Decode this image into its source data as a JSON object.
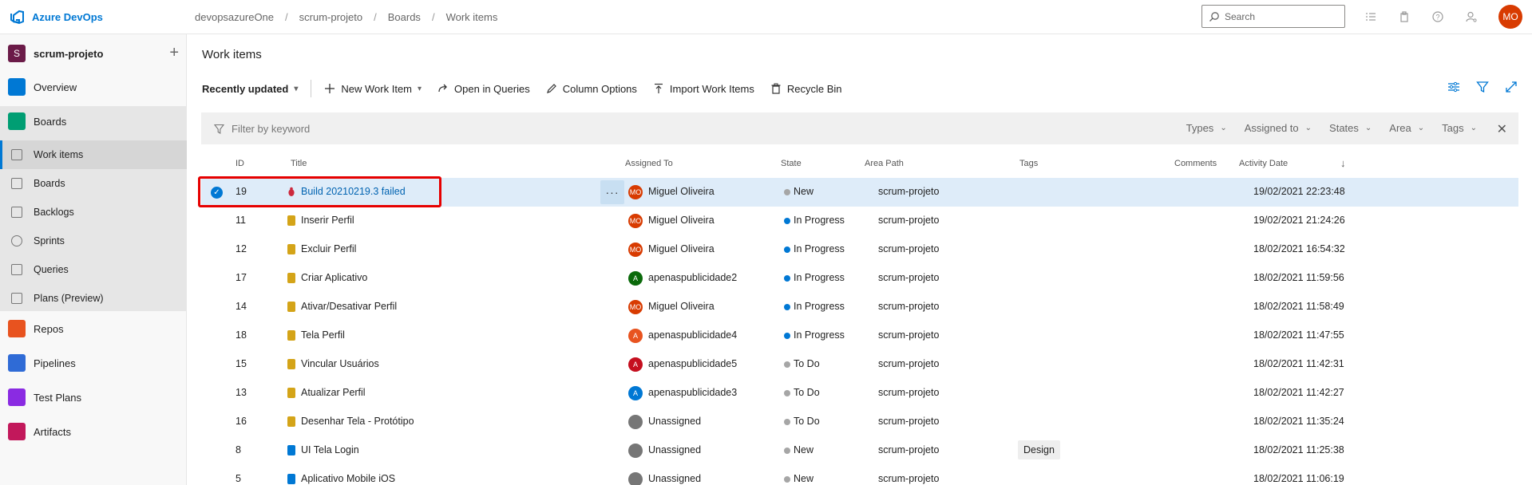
{
  "topbar": {
    "brand": "Azure DevOps",
    "breadcrumb": [
      "devopsazureOne",
      "scrum-projeto",
      "Boards",
      "Work items"
    ],
    "search_placeholder": "Search",
    "user_initials": "MO"
  },
  "sidebar": {
    "project_initial": "S",
    "project_name": "scrum-projeto",
    "add_symbol": "+",
    "items": [
      {
        "label": "Overview"
      },
      {
        "label": "Boards"
      },
      {
        "label": "Work items"
      },
      {
        "label": "Boards"
      },
      {
        "label": "Backlogs"
      },
      {
        "label": "Sprints"
      },
      {
        "label": "Queries"
      },
      {
        "label": "Plans (Preview)"
      },
      {
        "label": "Repos"
      },
      {
        "label": "Pipelines"
      },
      {
        "label": "Test Plans"
      },
      {
        "label": "Artifacts"
      }
    ]
  },
  "main": {
    "title": "Work items",
    "toolbar": {
      "view": "Recently updated",
      "new_item": "New Work Item",
      "open_queries": "Open in Queries",
      "column_options": "Column Options",
      "import": "Import Work Items",
      "recycle": "Recycle Bin"
    },
    "filter": {
      "placeholder": "Filter by keyword",
      "types": "Types",
      "assigned": "Assigned to",
      "states": "States",
      "area": "Area",
      "tags": "Tags"
    },
    "columns": {
      "id": "ID",
      "title": "Title",
      "assigned": "Assigned To",
      "state": "State",
      "area": "Area Path",
      "tags": "Tags",
      "comments": "Comments",
      "activity": "Activity Date",
      "sort": "↓"
    },
    "more_label": "···",
    "rows": [
      {
        "id": "19",
        "title": "Build 20210219.3 failed",
        "assigned": "Miguel Oliveira",
        "initials": "MO",
        "state": "New",
        "area": "scrum-projeto",
        "tags": "",
        "date": "19/02/2021 22:23:48"
      },
      {
        "id": "11",
        "title": "Inserir Perfil",
        "assigned": "Miguel Oliveira",
        "initials": "MO",
        "state": "In Progress",
        "area": "scrum-projeto",
        "tags": "",
        "date": "19/02/2021 21:24:26"
      },
      {
        "id": "12",
        "title": "Excluir Perfil",
        "assigned": "Miguel Oliveira",
        "initials": "MO",
        "state": "In Progress",
        "area": "scrum-projeto",
        "tags": "",
        "date": "18/02/2021 16:54:32"
      },
      {
        "id": "17",
        "title": "Criar Aplicativo",
        "assigned": "apenaspublicidade2",
        "initials": "A",
        "state": "In Progress",
        "area": "scrum-projeto",
        "tags": "",
        "date": "18/02/2021 11:59:56"
      },
      {
        "id": "14",
        "title": "Ativar/Desativar Perfil",
        "assigned": "Miguel Oliveira",
        "initials": "MO",
        "state": "In Progress",
        "area": "scrum-projeto",
        "tags": "",
        "date": "18/02/2021 11:58:49"
      },
      {
        "id": "18",
        "title": "Tela Perfil",
        "assigned": "apenaspublicidade4",
        "initials": "A",
        "state": "In Progress",
        "area": "scrum-projeto",
        "tags": "",
        "date": "18/02/2021 11:47:55"
      },
      {
        "id": "15",
        "title": "Vincular Usuários",
        "assigned": "apenaspublicidade5",
        "initials": "A",
        "state": "To Do",
        "area": "scrum-projeto",
        "tags": "",
        "date": "18/02/2021 11:42:31"
      },
      {
        "id": "13",
        "title": "Atualizar Perfil",
        "assigned": "apenaspublicidade3",
        "initials": "A",
        "state": "To Do",
        "area": "scrum-projeto",
        "tags": "",
        "date": "18/02/2021 11:42:27"
      },
      {
        "id": "16",
        "title": "Desenhar Tela - Protótipo",
        "assigned": "Unassigned",
        "initials": "",
        "state": "To Do",
        "area": "scrum-projeto",
        "tags": "",
        "date": "18/02/2021 11:35:24"
      },
      {
        "id": "8",
        "title": "UI Tela Login",
        "assigned": "Unassigned",
        "initials": "",
        "state": "New",
        "area": "scrum-projeto",
        "tags": "Design",
        "date": "18/02/2021 11:25:38"
      },
      {
        "id": "5",
        "title": "Aplicativo Mobile iOS",
        "assigned": "Unassigned",
        "initials": "",
        "state": "New",
        "area": "scrum-projeto",
        "tags": "",
        "date": "18/02/2021 11:06:19"
      }
    ]
  },
  "colors": {
    "accent": "#0078d4",
    "in_progress": "#0078d4",
    "new": "#a6a6a6",
    "todo": "#a6a6a6",
    "highlight_box": "#e60000"
  }
}
